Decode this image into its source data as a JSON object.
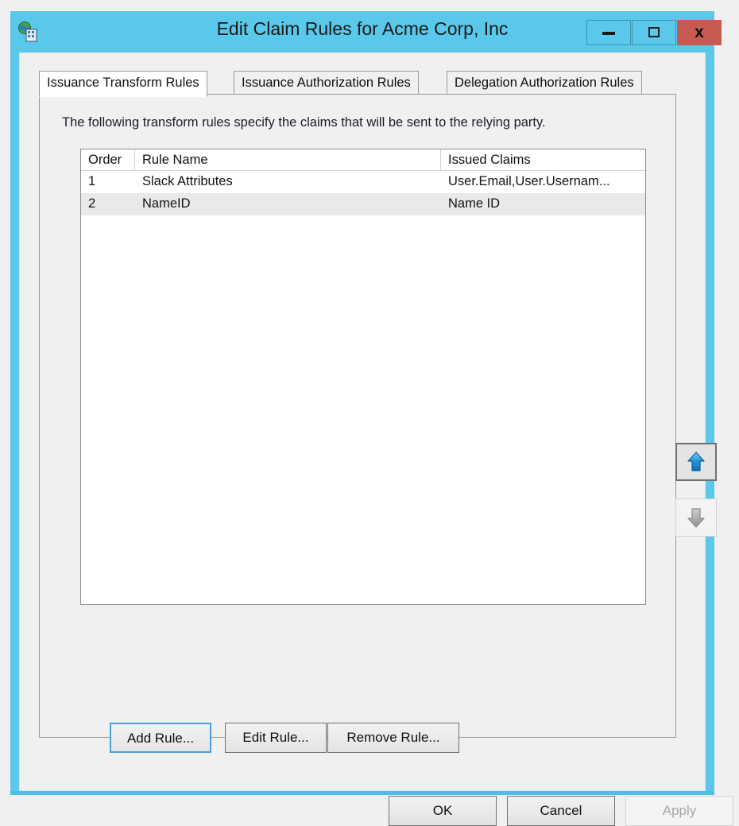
{
  "window": {
    "title": "Edit Claim Rules for Acme Corp, Inc",
    "icon": "relying-party-trust-icon",
    "controls": {
      "minimize_label": "–",
      "maximize_label": "□",
      "close_label": "x"
    },
    "frame_color": "#5ac8ea",
    "close_color": "#c75b52"
  },
  "tabs": [
    {
      "label": "Issuance Transform Rules",
      "active": true
    },
    {
      "label": "Issuance Authorization Rules",
      "active": false
    },
    {
      "label": "Delegation Authorization Rules",
      "active": false
    }
  ],
  "panel": {
    "description": "The following transform rules specify the claims that will be sent to the relying party."
  },
  "rules_table": {
    "columns": [
      "Order",
      "Rule Name",
      "Issued Claims"
    ],
    "rows": [
      {
        "order": "1",
        "rule_name": "Slack Attributes",
        "issued_claims": "User.Email,User.Usernam...",
        "selected": false
      },
      {
        "order": "2",
        "rule_name": "NameID",
        "issued_claims": "Name ID",
        "selected": true
      }
    ]
  },
  "reorder": {
    "up": {
      "name": "move-up-button",
      "enabled": true,
      "color": "#2a96d8"
    },
    "down": {
      "name": "move-down-button",
      "enabled": false,
      "color": "#a8a8a8"
    }
  },
  "rule_actions": {
    "add_label": "Add Rule...",
    "edit_label": "Edit Rule...",
    "remove_label": "Remove Rule..."
  },
  "dialog_actions": {
    "ok_label": "OK",
    "cancel_label": "Cancel",
    "apply_label": "Apply",
    "apply_enabled": false
  }
}
